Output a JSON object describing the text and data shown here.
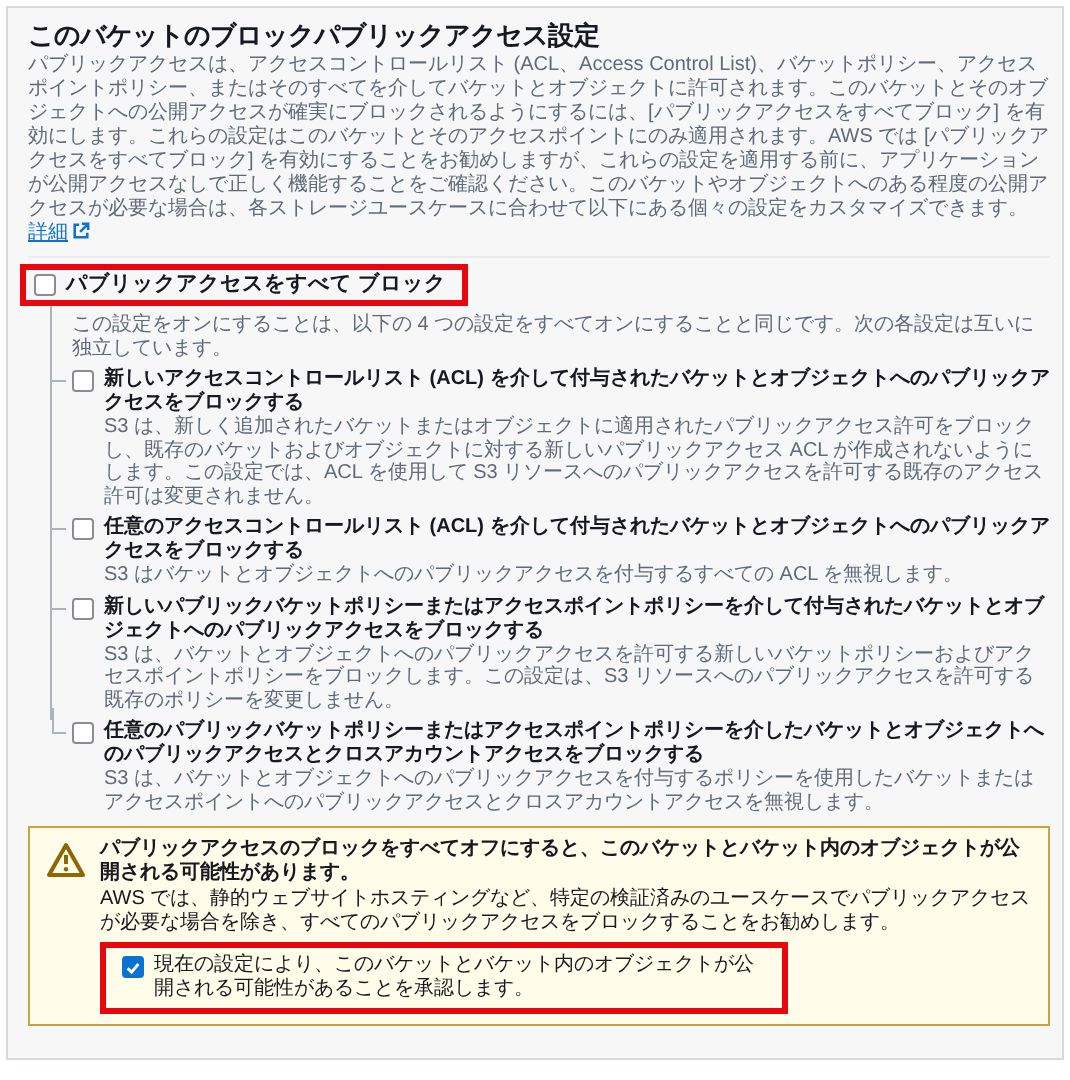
{
  "panel": {
    "title": "このバケットのブロックパブリックアクセス設定",
    "description": "パブリックアクセスは、アクセスコントロールリスト (ACL、Access Control List)、バケットポリシー、アクセスポイントポリシー、またはそのすべてを介してバケットとオブジェクトに許可されます。このバケットとそのオブジェクトへの公開アクセスが確実にブロックされるようにするには、[パブリックアクセスをすべてブロック] を有効にします。これらの設定はこのバケットとそのアクセスポイントにのみ適用されます。AWS では [パブリックアクセスをすべてブロック] を有効にすることをお勧めしますが、これらの設定を適用する前に、アプリケーションが公開アクセスなしで正しく機能することをご確認ください。このバケットやオブジェクトへのある程度の公開アクセスが必要な場合は、各ストレージユースケースに合わせて以下にある個々の設定をカスタマイズできます。",
    "link": "詳細"
  },
  "block_all": {
    "label": "パブリックアクセスをすべて ブロック",
    "description": "この設定をオンにすることは、以下の 4 つの設定をすべてオンにすることと同じです。次の各設定は互いに独立しています。",
    "checked": false,
    "highlighted": true
  },
  "settings": [
    {
      "label": "新しいアクセスコントロールリスト (ACL) を介して付与されたバケットとオブジェクトへのパブリックアクセスをブロックする",
      "description": "S3 は、新しく追加されたバケットまたはオブジェクトに適用されたパブリックアクセス許可をブロックし、既存のバケットおよびオブジェクトに対する新しいパブリックアクセス ACL が作成されないようにします。この設定では、ACL を使用して S3 リソースへのパブリックアクセスを許可する既存のアクセス許可は変更されません。",
      "checked": false
    },
    {
      "label": "任意のアクセスコントロールリスト (ACL) を介して付与されたバケットとオブジェクトへのパブリックアクセスをブロックする",
      "description": "S3 はバケットとオブジェクトへのパブリックアクセスを付与するすべての ACL を無視します。",
      "checked": false
    },
    {
      "label": "新しいパブリックバケットポリシーまたはアクセスポイントポリシーを介して付与されたバケットとオブジェクトへのパブリックアクセスをブロックする",
      "description": "S3 は、バケットとオブジェクトへのパブリックアクセスを許可する新しいバケットポリシーおよびアクセスポイントポリシーをブロックします。この設定は、S3 リソースへのパブリックアクセスを許可する既存のポリシーを変更しません。",
      "checked": false
    },
    {
      "label": "任意のパブリックバケットポリシーまたはアクセスポイントポリシーを介したバケットとオブジェクトへのパブリックアクセスとクロスアカウントアクセスをブロックする",
      "description": "S3 は、バケットとオブジェクトへのパブリックアクセスを付与するポリシーを使用したバケットまたはアクセスポイントへのパブリックアクセスとクロスアカウントアクセスを無視します。",
      "checked": false
    }
  ],
  "warning": {
    "title": "パブリックアクセスのブロックをすべてオフにすると、このバケットとバケット内のオブジェクトが公開される可能性があります。",
    "text": "AWS では、静的ウェブサイトホスティングなど、特定の検証済みのユースケースでパブリックアクセスが必要な場合を除き、すべてのパブリックアクセスをブロックすることをお勧めします。",
    "acknowledge": {
      "label": "現在の設定により、このバケットとバケット内のオブジェクトが公開される可能性があることを承認します。",
      "checked": true,
      "highlighted": true
    }
  }
}
